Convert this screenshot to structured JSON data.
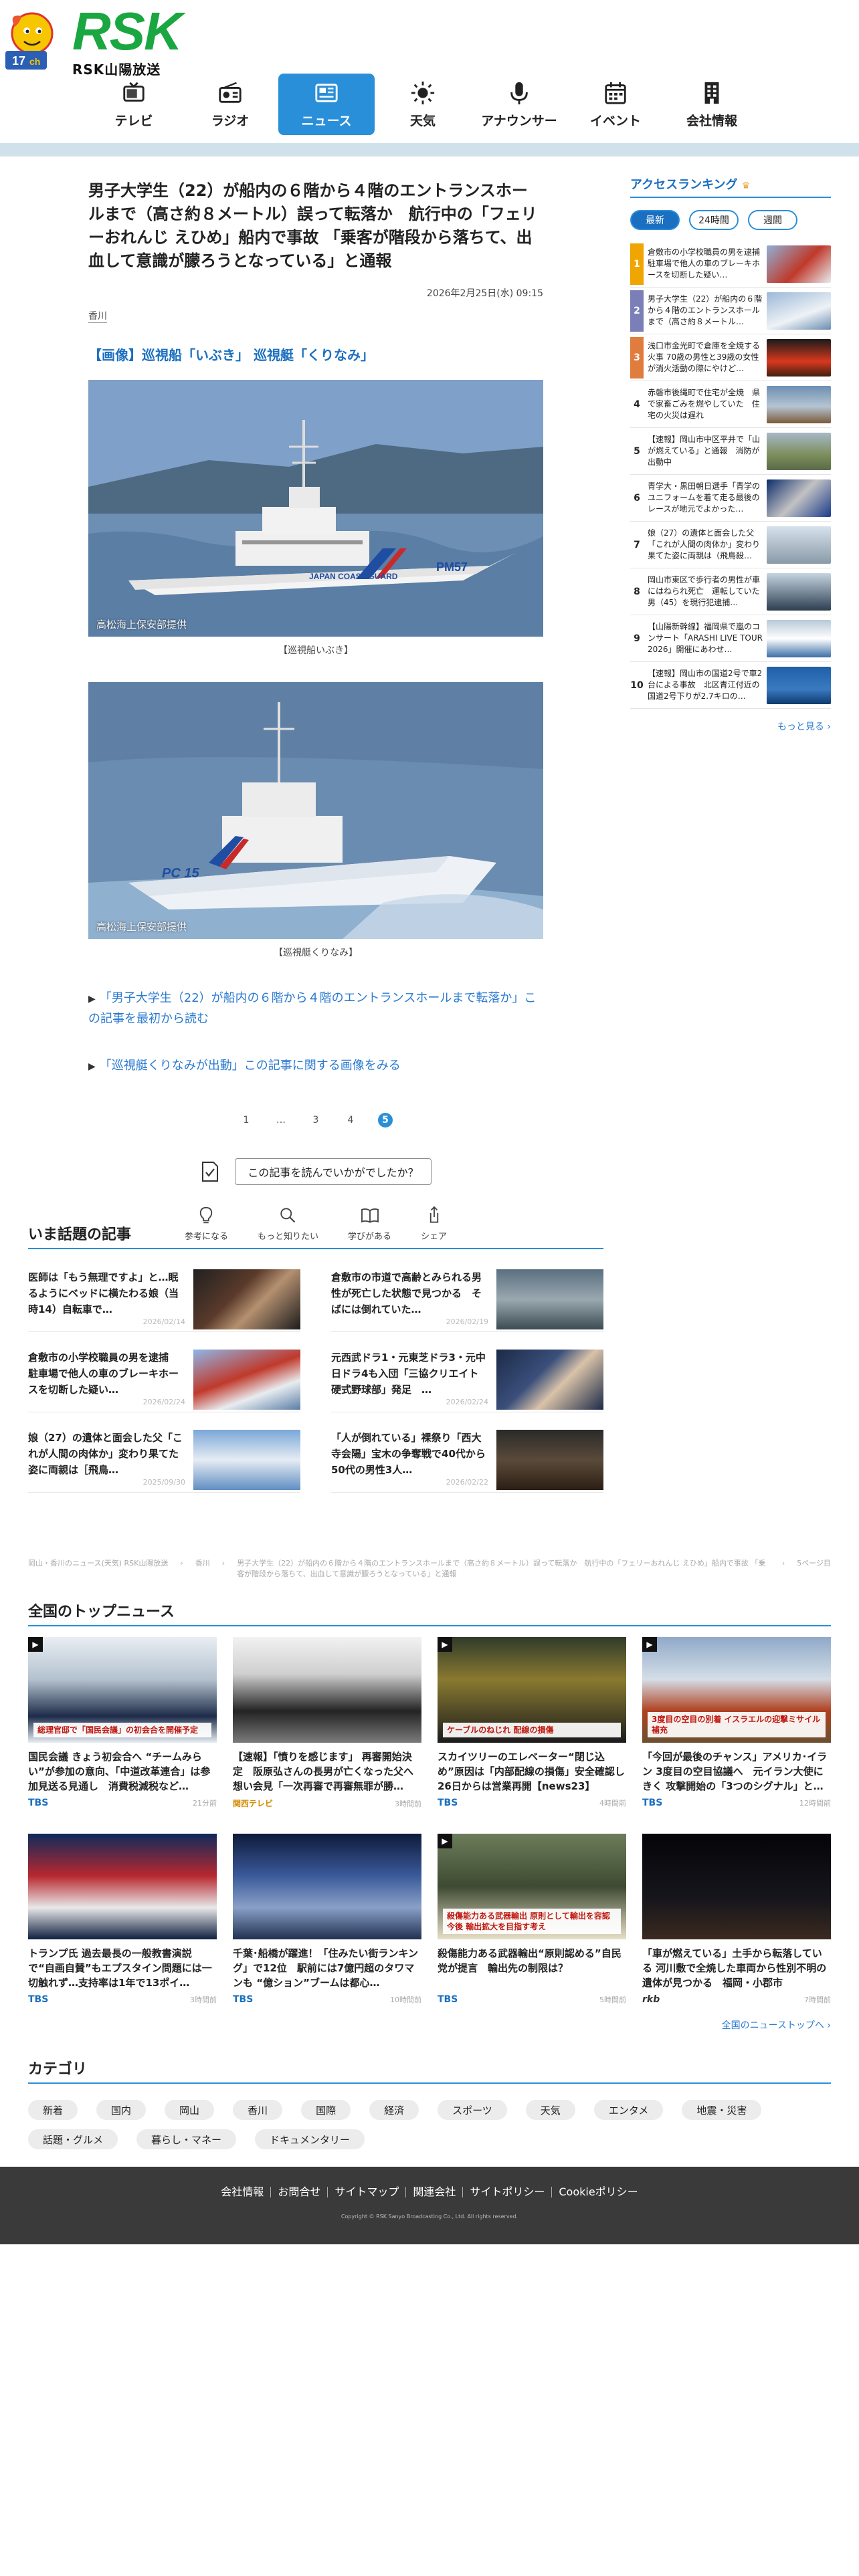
{
  "header": {
    "logo_text": "RSK",
    "logo_sub": "RSK山陽放送",
    "nav": [
      {
        "label": "テレビ",
        "icon": "tv-icon"
      },
      {
        "label": "ラジオ",
        "icon": "radio-icon"
      },
      {
        "label": "ニュース",
        "icon": "news-icon",
        "active": true
      },
      {
        "label": "天気",
        "icon": "sun-icon"
      },
      {
        "label": "アナウンサー",
        "icon": "microphone-icon"
      },
      {
        "label": "イベント",
        "icon": "calendar-icon"
      },
      {
        "label": "会社情報",
        "icon": "building-icon"
      }
    ]
  },
  "article": {
    "title": "男子大学生（22）が船内の６階から４階のエントランスホールまで（高さ約８メートル）誤って転落か　航行中の「フェリーおれんじ えひめ」船内で事故 「乗客が階段から落ちて、出血して意識が朦ろうとなっている」と通報",
    "date": "2026年2月25日(水) 09:15",
    "tag": "香川",
    "subhead": "【画像】巡視船「いぶき」 巡視艇「くりなみ」",
    "photos": [
      {
        "credit": "高松海上保安部提供",
        "caption": "【巡視船いぶき】",
        "hull_text": "JAPAN COAST GUARD",
        "hull_code": "PM57"
      },
      {
        "credit": "高松海上保安部提供",
        "caption": "【巡視艇くりなみ】",
        "hull_code": "PC 15"
      }
    ],
    "link1": "「男子大学生（22）が船内の６階から４階のエントランスホールまで転落か」この記事を最初から読む",
    "link2": "「巡視艇くりなみが出動」この記事に関する画像をみる",
    "pager": [
      "1",
      "…",
      "3",
      "4",
      "5"
    ],
    "pager_current": "5",
    "survey": "この記事を読んでいかがでしたか？",
    "reactions": [
      {
        "label": "参考になる",
        "icon": "bulb-icon"
      },
      {
        "label": "もっと知りたい",
        "icon": "magnifier-icon"
      },
      {
        "label": "学びがある",
        "icon": "book-icon"
      },
      {
        "label": "シェア",
        "icon": "share-icon"
      }
    ]
  },
  "ranking": {
    "title": "アクセスランキング",
    "tabs": [
      "最新",
      "24時間",
      "週間"
    ],
    "active_tab": "最新",
    "items": [
      {
        "rank": "1",
        "text": "倉敷市の小学校職員の男を逮捕 駐車場で他人の車のブレーキホースを切断した疑い…"
      },
      {
        "rank": "2",
        "text": "男子大学生（22）が船内の６階から４階のエントランスホールまで（高さ約８メートル…"
      },
      {
        "rank": "3",
        "text": "浅口市金光町で倉庫を全焼する火事 70歳の男性と39歳の女性が消火活動の際にやけど…"
      },
      {
        "rank": "4",
        "text": "赤磐市後縄町で住宅が全焼　県で家畜ごみを燃やしていた　住宅の火災は遅れ"
      },
      {
        "rank": "5",
        "text": "【速報】岡山市中区平井で「山が燃えている」と通報　消防が出動中"
      },
      {
        "rank": "6",
        "text": "青学大・黒田朝日選手「青学のユニフォームを着て走る最後のレースが地元でよかった…"
      },
      {
        "rank": "7",
        "text": "娘（27）の遺体と面会した父「これが人間の肉体か」変わり果てた姿に両親は（飛鳥殺…"
      },
      {
        "rank": "8",
        "text": "岡山市東区で歩行者の男性が車にはねられ死亡　運転していた男（45）を現行犯逮捕…"
      },
      {
        "rank": "9",
        "text": "【山陽新幹線】福岡県で嵐のコンサート「ARASHI LIVE TOUR 2026」開催にあわせ…"
      },
      {
        "rank": "10",
        "text": "【速報】岡山市の国道2号で車2台による事故　北区青江付近の国道2号下りが2.7キロの…"
      }
    ],
    "more": "もっと見る"
  },
  "topics": {
    "title": "いま話題の記事",
    "items": [
      {
        "title": "医師は「もう無理ですよ」と…眠るようにベッドに横たわる娘（当時14）自転車で…",
        "date": "2026/02/14"
      },
      {
        "title": "倉敷市の市道で高齢とみられる男性が死亡した状態で見つかる　そばには倒れていた…",
        "date": "2026/02/19"
      },
      {
        "title": "倉敷市の小学校職員の男を逮捕　駐車場で他人の車のブレーキホースを切断した疑い…",
        "date": "2026/02/24"
      },
      {
        "title": "元西武ドラ1・元東芝ドラ3・元中日ドラ4も入団「三協クリエイト硬式野球部」発足　…",
        "date": "2026/02/24"
      },
      {
        "title": "娘（27）の遺体と面会した父「これが人間の肉体か」変わり果てた姿に両親は［飛鳥…",
        "date": "2025/09/30"
      },
      {
        "title": "「人が倒れている」裸祭り「西大寺会陽」宝木の争奪戦で40代から50代の男性3人…",
        "date": "2026/02/22"
      }
    ]
  },
  "breadcrumb": {
    "items": [
      "岡山・香川のニュース(天気) RSK山陽放送",
      "香川",
      "男子大学生（22）が船内の６階から４階のエントランスホールまで（高さ約８メートル）誤って転落か　航行中の「フェリーおれんじ えひめ」船内で事故 「乗客が階段から落ちて、出血して意識が朦ろうとなっている」と通報",
      "5ページ目"
    ]
  },
  "national": {
    "title": "全国のトップニュース",
    "items": [
      {
        "title": "国民会議 きょう初会合へ “チームみらい”が参加の意向、「中道改革連合」は参加見送る見通し　消費税減税など…",
        "source": "TBS",
        "time": "21分前",
        "img_text": "総理官邸で「国民会議」の初会合を開催予定"
      },
      {
        "title": "【速報】「憤りを感じます」 再審開始決定　阪原弘さんの長男が亡くなった父へ想い会見「一次再審で再審無罪が勝…",
        "source": "関西テレビ",
        "time": "3時間前",
        "img_text": ""
      },
      {
        "title": "スカイツリーのエレベーター“閉じ込め”原因は「内部配線の損傷」安全確認し26日からは営業再開【news23】",
        "source": "TBS",
        "time": "4時間前",
        "img_text": "ケーブルのねじれ 配線の損傷"
      },
      {
        "title": "「今回が最後のチャンス」アメリカ･イラン 3度目の空目協議へ　元イラン大使にきく 攻撃開始の「3つのシグナル」と…",
        "source": "TBS",
        "time": "12時間前",
        "img_text": "3度目の空目の別着 イスラエルの迎撃ミサイル補充"
      },
      {
        "title": "トランプ氏 過去最長の一般教書演説で“自画自賛”もエプスタイン問題には一切触れず…支持率は1年で13ポイ…",
        "source": "TBS",
        "time": "3時間前",
        "img_text": ""
      },
      {
        "title": "千葉･船橋が躍進！「住みたい街ランキング」で12位　駅前には7億円超のタワマンも “億ション”ブームは都心…",
        "source": "TBS",
        "time": "10時間前",
        "img_text": ""
      },
      {
        "title": "殺傷能力ある武器輸出“原則認める”自民党が提言　輸出先の制限は？",
        "source": "TBS",
        "time": "5時間前",
        "img_text": "殺傷能力ある武器輸出 原則として輸出を容認 今後 輸出拡大を目指す考え"
      },
      {
        "title": "「車が燃えている」土手から転落している 河川敷で全焼した車両から性別不明の遺体が見つかる　福岡・小郡市",
        "source": "rkb",
        "time": "7時間前",
        "img_text": ""
      }
    ],
    "all_link": "全国のニューストップへ"
  },
  "category": {
    "title": "カテゴリ",
    "chips": [
      "新着",
      "国内",
      "岡山",
      "香川",
      "国際",
      "経済",
      "スポーツ",
      "天気",
      "エンタメ",
      "地震・災害",
      "話題・グルメ",
      "暮らし・マネー",
      "ドキュメンタリー"
    ]
  },
  "footer": {
    "links": [
      "会社情報",
      "お問合せ",
      "サイトマップ",
      "関連会社",
      "サイトポリシー",
      "Cookieポリシー"
    ],
    "copyright": "Copyright © RSK Sanyo Broadcasting Co., Ltd. All rights reserved."
  },
  "colors": {
    "brand_green": "#1aa640",
    "accent_blue": "#2a8fd9",
    "link_blue": "#2a7ad0",
    "footer_bg": "#3a3a3a"
  }
}
